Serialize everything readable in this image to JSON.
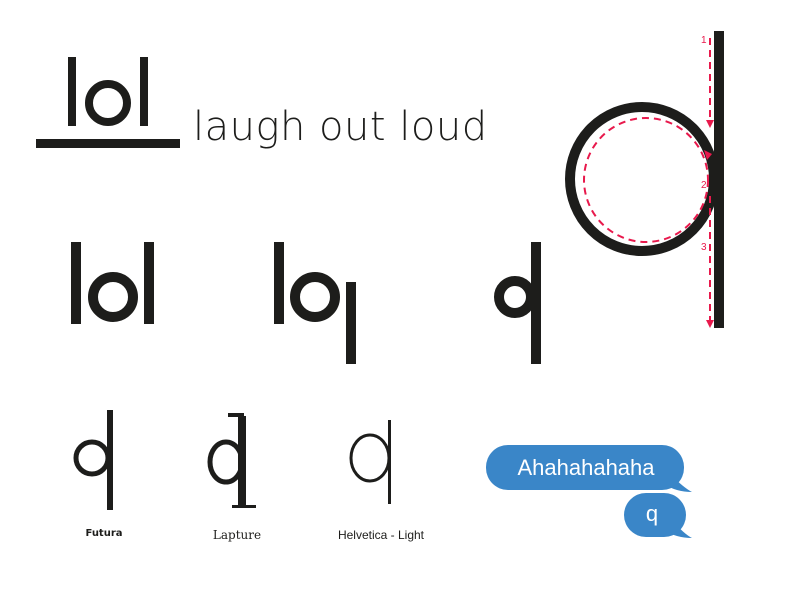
{
  "logo": {
    "word": "lol",
    "tagline": "laugh out loud"
  },
  "construction_steps": [
    "1",
    "2",
    "3"
  ],
  "font_samples": [
    {
      "label": "Futura"
    },
    {
      "label": "Lapture"
    },
    {
      "label": "Helvetica - Light"
    }
  ],
  "chat": {
    "message_1": "Ahahahahaha",
    "message_2": "q"
  },
  "colors": {
    "ink": "#1d1d1b",
    "guide": "#e8194c",
    "bubble": "#3a86c8"
  }
}
